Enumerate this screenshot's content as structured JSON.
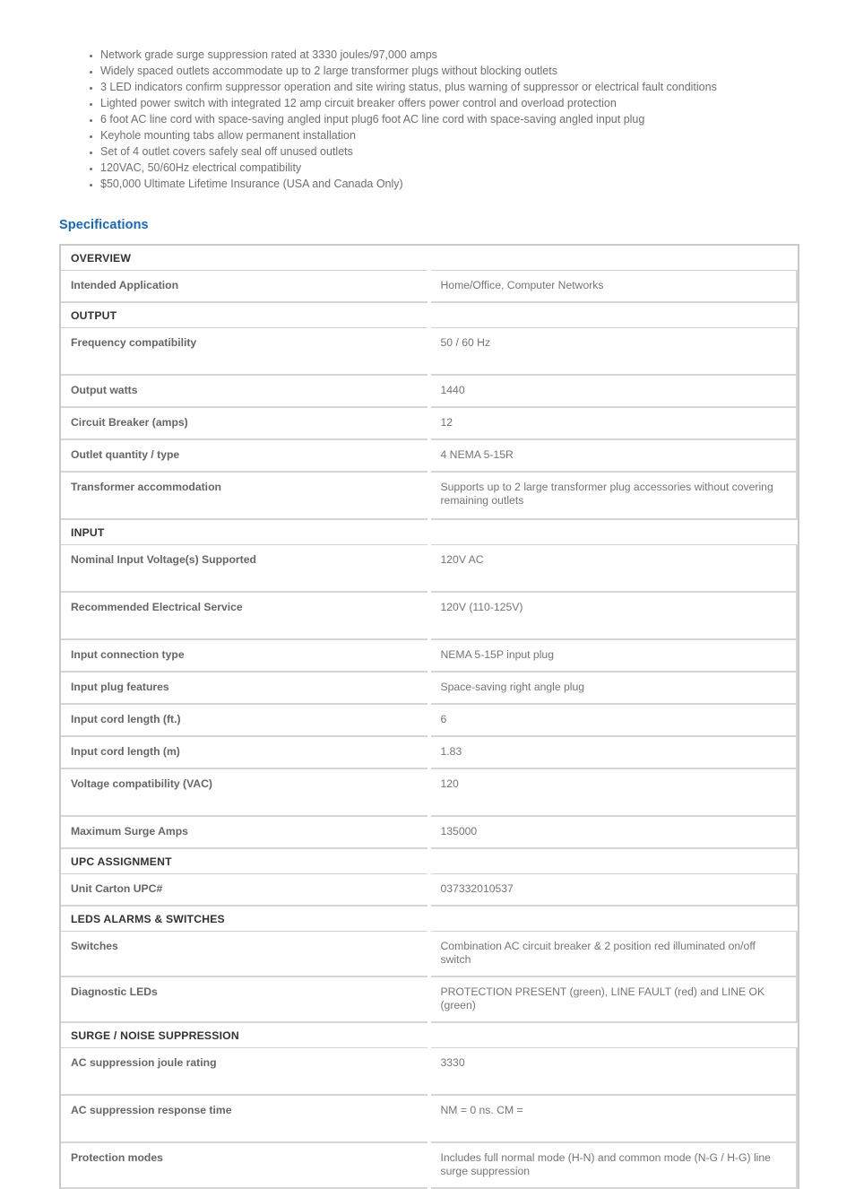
{
  "features": [
    "Network grade surge suppression rated at 3330 joules/97,000 amps",
    "Widely spaced outlets accommodate up to 2 large transformer plugs without blocking outlets",
    "3 LED indicators confirm suppressor operation and site wiring status, plus warning of suppressor or electrical fault conditions",
    "Lighted power switch with integrated 12 amp circuit breaker offers power control and overload protection",
    "6 foot AC line cord with space-saving angled input plug6 foot AC line cord with space-saving angled input plug",
    "Keyhole mounting tabs allow permanent installation",
    "Set of 4 outlet covers safely seal off unused outlets",
    "120VAC, 50/60Hz electrical compatibility",
    "$50,000 Ultimate Lifetime Insurance (USA and Canada Only)"
  ],
  "specifications": {
    "heading": "Specifications",
    "heading_color": "#1069c9",
    "sections": [
      {
        "title": "OVERVIEW",
        "rows": [
          {
            "label": "Intended Application",
            "value": "Home/Office, Computer Networks",
            "tall": false
          }
        ]
      },
      {
        "title": "OUTPUT",
        "rows": [
          {
            "label": "Frequency compatibility",
            "value": "50 / 60 Hz",
            "tall": true
          },
          {
            "label": "Output watts",
            "value": "1440",
            "tall": false
          },
          {
            "label": "Circuit Breaker (amps)",
            "value": "12",
            "tall": false
          },
          {
            "label": "Outlet quantity / type",
            "value": "4 NEMA 5-15R",
            "tall": false
          },
          {
            "label": "Transformer accommodation",
            "value": "Supports up to 2 large transformer plug accessories without covering remaining outlets",
            "tall": true
          }
        ]
      },
      {
        "title": "INPUT",
        "rows": [
          {
            "label": "Nominal Input Voltage(s) Supported",
            "value": "120V AC",
            "tall": true
          },
          {
            "label": "Recommended Electrical Service",
            "value": "120V (110-125V)",
            "tall": true
          },
          {
            "label": "Input connection type",
            "value": "NEMA 5-15P input plug",
            "tall": false
          },
          {
            "label": "Input plug features",
            "value": "Space-saving right angle plug",
            "tall": false
          },
          {
            "label": "Input cord length (ft.)",
            "value": "6",
            "tall": false
          },
          {
            "label": "Input cord length (m)",
            "value": "1.83",
            "tall": false
          },
          {
            "label": "Voltage compatibility (VAC)",
            "value": "120",
            "tall": true
          },
          {
            "label": "Maximum Surge Amps",
            "value": "135000",
            "tall": false
          }
        ]
      },
      {
        "title": "UPC ASSIGNMENT",
        "rows": [
          {
            "label": "Unit Carton UPC#",
            "value": "037332010537",
            "tall": false
          }
        ]
      },
      {
        "title": "LEDS ALARMS & SWITCHES",
        "rows": [
          {
            "label": "Switches",
            "value": "Combination AC circuit breaker & 2 position red illuminated on/off switch",
            "tall": false
          },
          {
            "label": "Diagnostic LEDs",
            "value": "PROTECTION PRESENT (green), LINE FAULT (red) and LINE OK (green)",
            "tall": false
          }
        ]
      },
      {
        "title": "SURGE / NOISE SUPPRESSION",
        "rows": [
          {
            "label": "AC suppression joule rating",
            "value": "3330",
            "tall": true
          },
          {
            "label": "AC suppression response time",
            "value": "NM = 0 ns. CM =",
            "tall": true
          },
          {
            "label": "Protection modes",
            "value": "Includes full normal mode (H-N) and common mode (N-G / H-G) line surge suppression",
            "tall": false
          }
        ]
      }
    ]
  }
}
